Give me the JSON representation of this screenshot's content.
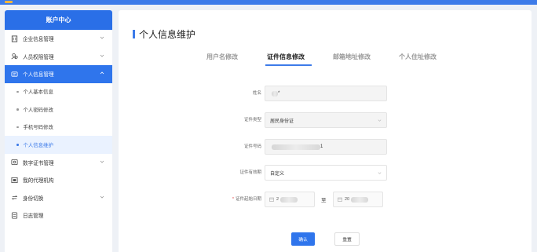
{
  "sidebar": {
    "header": "账户中心",
    "items": [
      {
        "label": "企业信息管理",
        "icon": "building-icon",
        "expandable": true
      },
      {
        "label": "人员权限管理",
        "icon": "user-group-icon",
        "expandable": true
      },
      {
        "label": "个人信息管理",
        "icon": "id-card-icon",
        "expandable": true,
        "active": true,
        "children": [
          {
            "label": "个人基本信息"
          },
          {
            "label": "个人密码修改"
          },
          {
            "label": "手机号码修改"
          },
          {
            "label": "个人信息维护",
            "current": true
          }
        ]
      },
      {
        "label": "数字证书管理",
        "icon": "certificate-icon",
        "expandable": true
      },
      {
        "label": "我的代理机构",
        "icon": "agency-icon",
        "expandable": false
      },
      {
        "label": "身份切换",
        "icon": "switch-icon",
        "expandable": true
      },
      {
        "label": "日志管理",
        "icon": "log-icon",
        "expandable": false
      }
    ]
  },
  "main": {
    "title": "个人信息维护",
    "tabs": [
      {
        "label": "用户名修改"
      },
      {
        "label": "证件信息修改",
        "active": true
      },
      {
        "label": "邮箱地址修改"
      },
      {
        "label": "个人住址修改"
      }
    ],
    "form": {
      "name_label": "姓名",
      "name_value": "*",
      "id_type_label": "证件类型",
      "id_type_value": "居民身份证",
      "id_number_label": "证件号码",
      "id_number_value": "1",
      "validity_label": "证件有效期",
      "validity_value": "自定义",
      "start_date_label": "证件起始日期",
      "start_date_value": "2",
      "end_date_prefix": "20",
      "range_separator": "至"
    },
    "buttons": {
      "confirm": "确认",
      "reset": "重置"
    }
  },
  "colors": {
    "primary": "#2f75ec",
    "topbar": "#3d7be9",
    "background": "#eef1f6"
  }
}
